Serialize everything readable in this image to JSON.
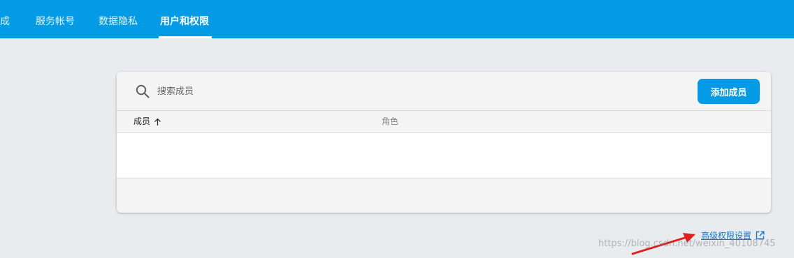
{
  "colors": {
    "brand": "#039be5",
    "background": "#e9ecef",
    "link": "#1a73c8",
    "annotation_arrow": "#e02020"
  },
  "topnav": {
    "tabs": [
      {
        "label": "成",
        "active": false
      },
      {
        "label": "服务帐号",
        "active": false
      },
      {
        "label": "数据隐私",
        "active": false
      },
      {
        "label": "用户和权限",
        "active": true
      }
    ]
  },
  "members_panel": {
    "search": {
      "placeholder": "搜索成员",
      "icon": "search-icon"
    },
    "add_button_label": "添加成员",
    "columns": {
      "member": "成员",
      "role": "角色"
    },
    "sort_icon": "arrow-up-icon",
    "rows": []
  },
  "advanced_link": {
    "label": "高级权限设置",
    "icon": "external-link-icon"
  },
  "watermark": "https://blog.csdn.net/weixin_40108745"
}
